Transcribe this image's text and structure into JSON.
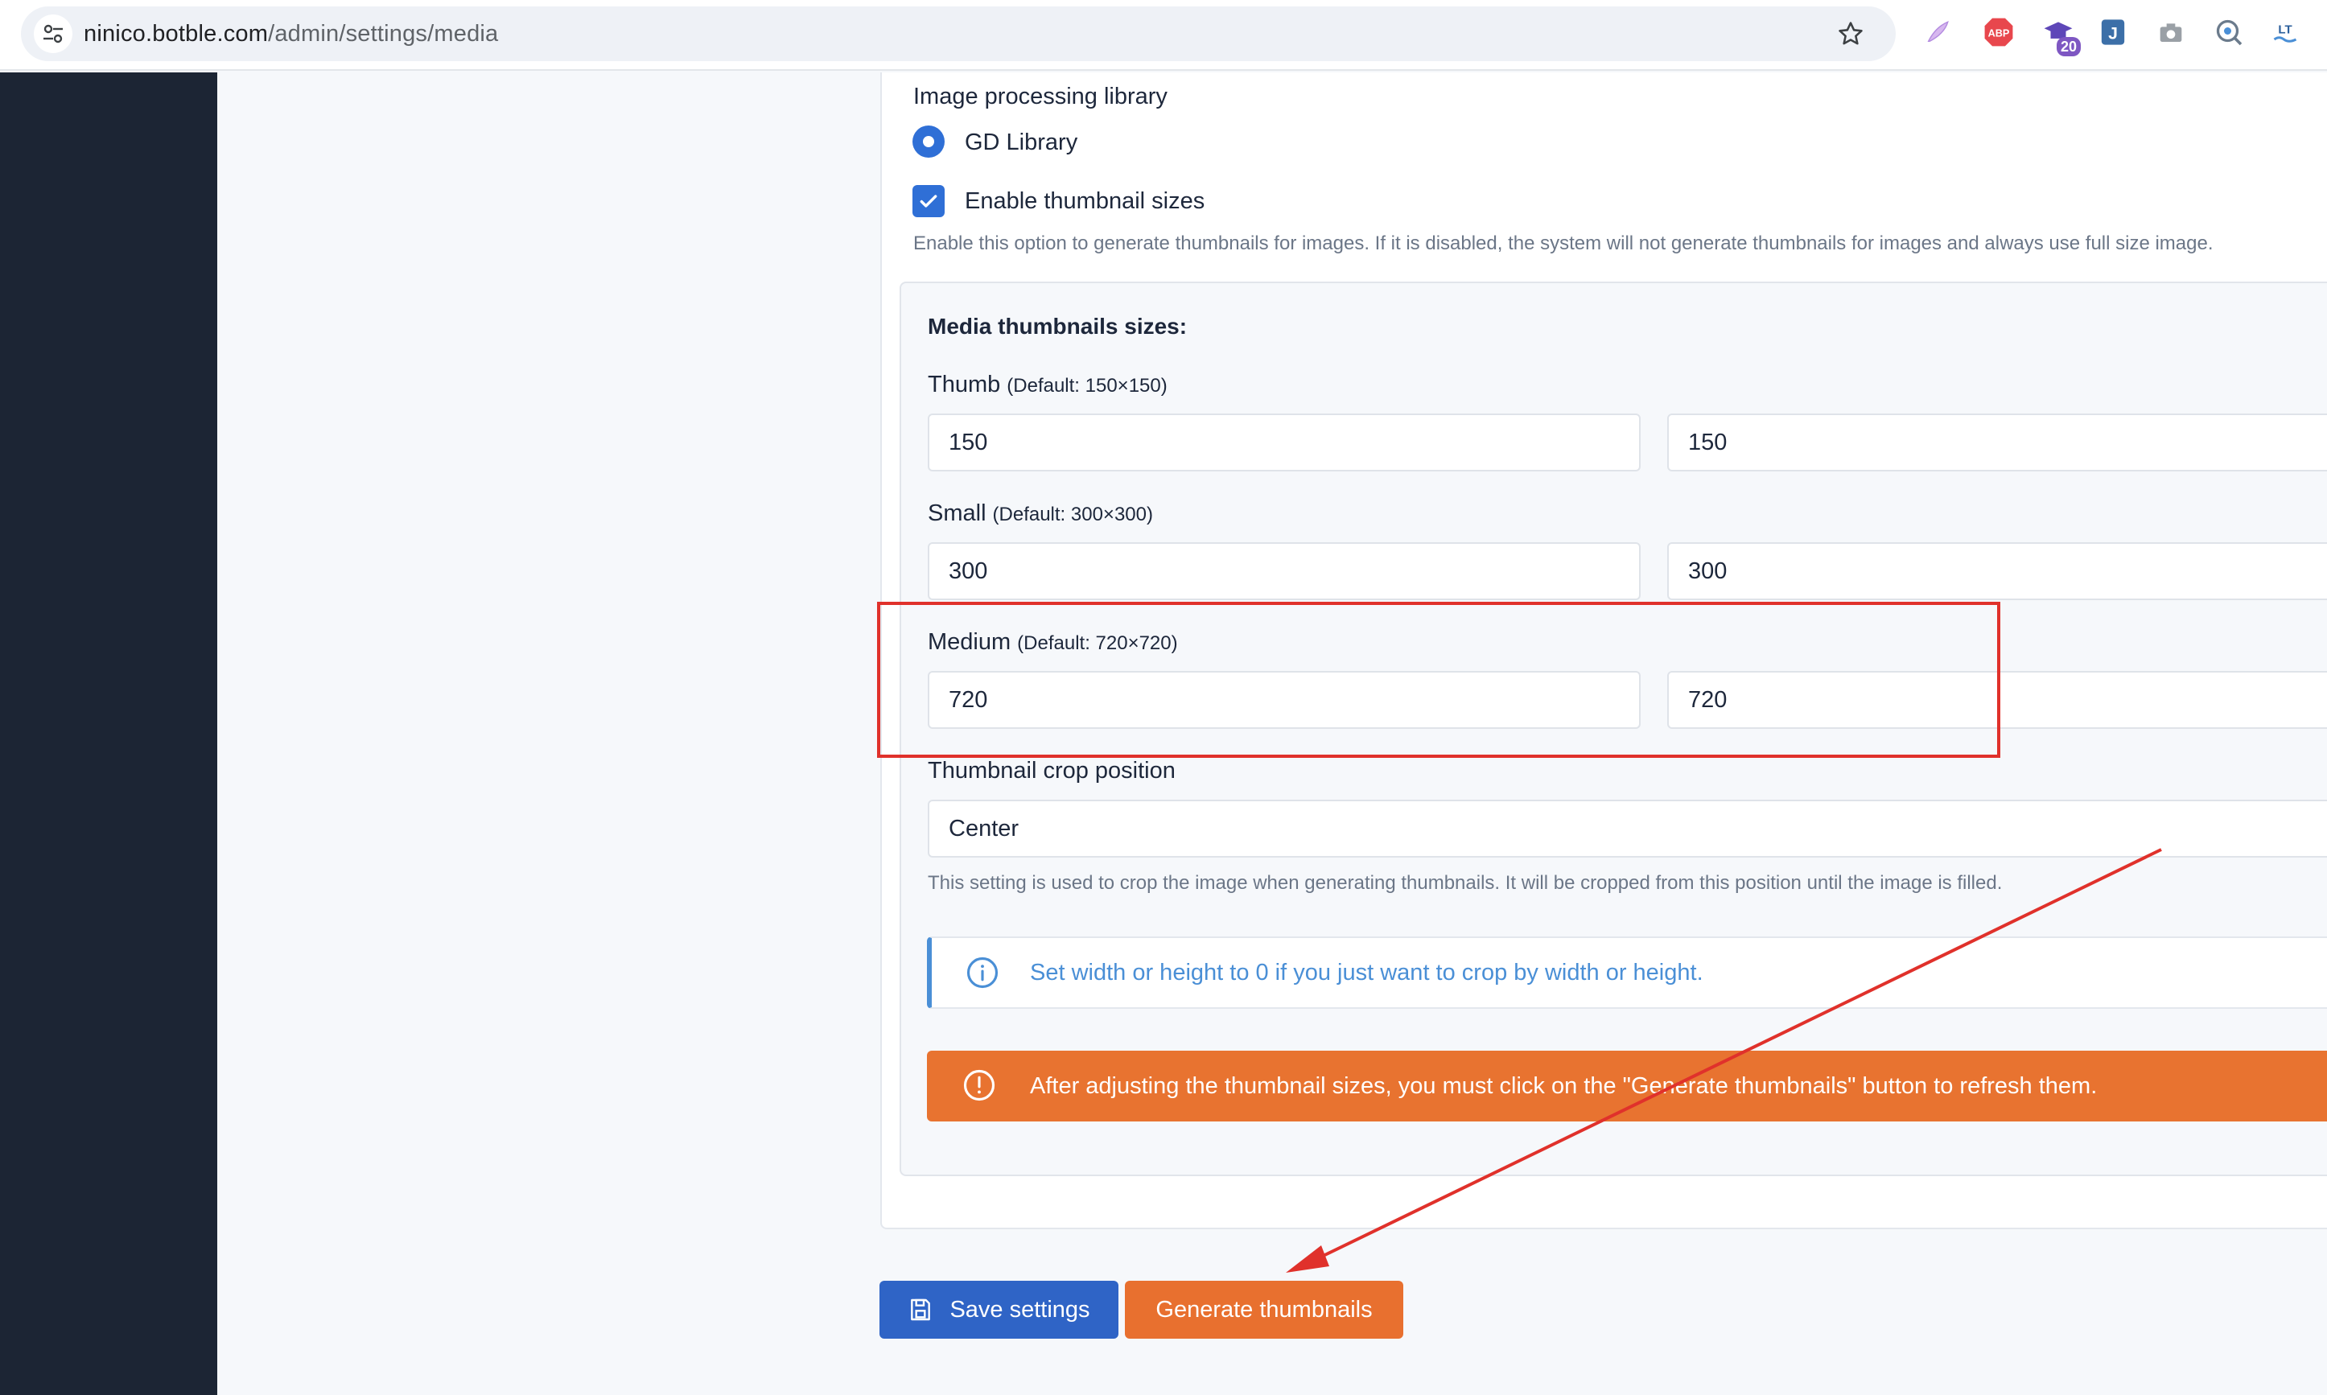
{
  "browser": {
    "url_host": "ninico.botble.com",
    "url_path": "/admin/settings/media",
    "extensions": [
      {
        "name": "feather-icon"
      },
      {
        "name": "adblock-icon",
        "text": "ABP"
      },
      {
        "name": "graduation-icon",
        "badge": "20"
      },
      {
        "name": "bookmark-j-icon",
        "text": "J"
      },
      {
        "name": "camera-icon"
      },
      {
        "name": "lens-icon"
      },
      {
        "name": "translate-icon",
        "text": "LT"
      }
    ]
  },
  "settings": {
    "image_library_label": "Image processing library",
    "gd_library_label": "GD Library",
    "enable_thumbnails_label": "Enable thumbnail sizes",
    "enable_thumbnails_hint": "Enable this option to generate thumbnails for images. If it is disabled, the system will not generate thumbnails for images and always use full size image.",
    "thumbnail_sizes_title": "Media thumbnails sizes:",
    "sizes": [
      {
        "name": "Thumb",
        "default": "(Default: 150×150)",
        "width": "150",
        "height": "150"
      },
      {
        "name": "Small",
        "default": "(Default: 300×300)",
        "width": "300",
        "height": "300"
      },
      {
        "name": "Medium",
        "default": "(Default: 720×720)",
        "width": "720",
        "height": "720"
      }
    ],
    "crop_position_label": "Thumbnail crop position",
    "crop_position_value": "Center",
    "crop_position_hint": "This setting is used to crop the image when generating thumbnails. It will be cropped from this position until the image is filled.",
    "info_alert": "Set width or height to 0 if you just want to crop by width or height.",
    "warning_alert": "After adjusting the thumbnail sizes, you must click on the \"Generate thumbnails\" button to refresh them."
  },
  "actions": {
    "save_label": "Save settings",
    "generate_label": "Generate thumbnails"
  },
  "colors": {
    "primary": "#2f64c6",
    "orange": "#e8702f",
    "info": "#4a8fd6",
    "sidebar": "#1c2534",
    "annotation_red": "#e0312b"
  }
}
